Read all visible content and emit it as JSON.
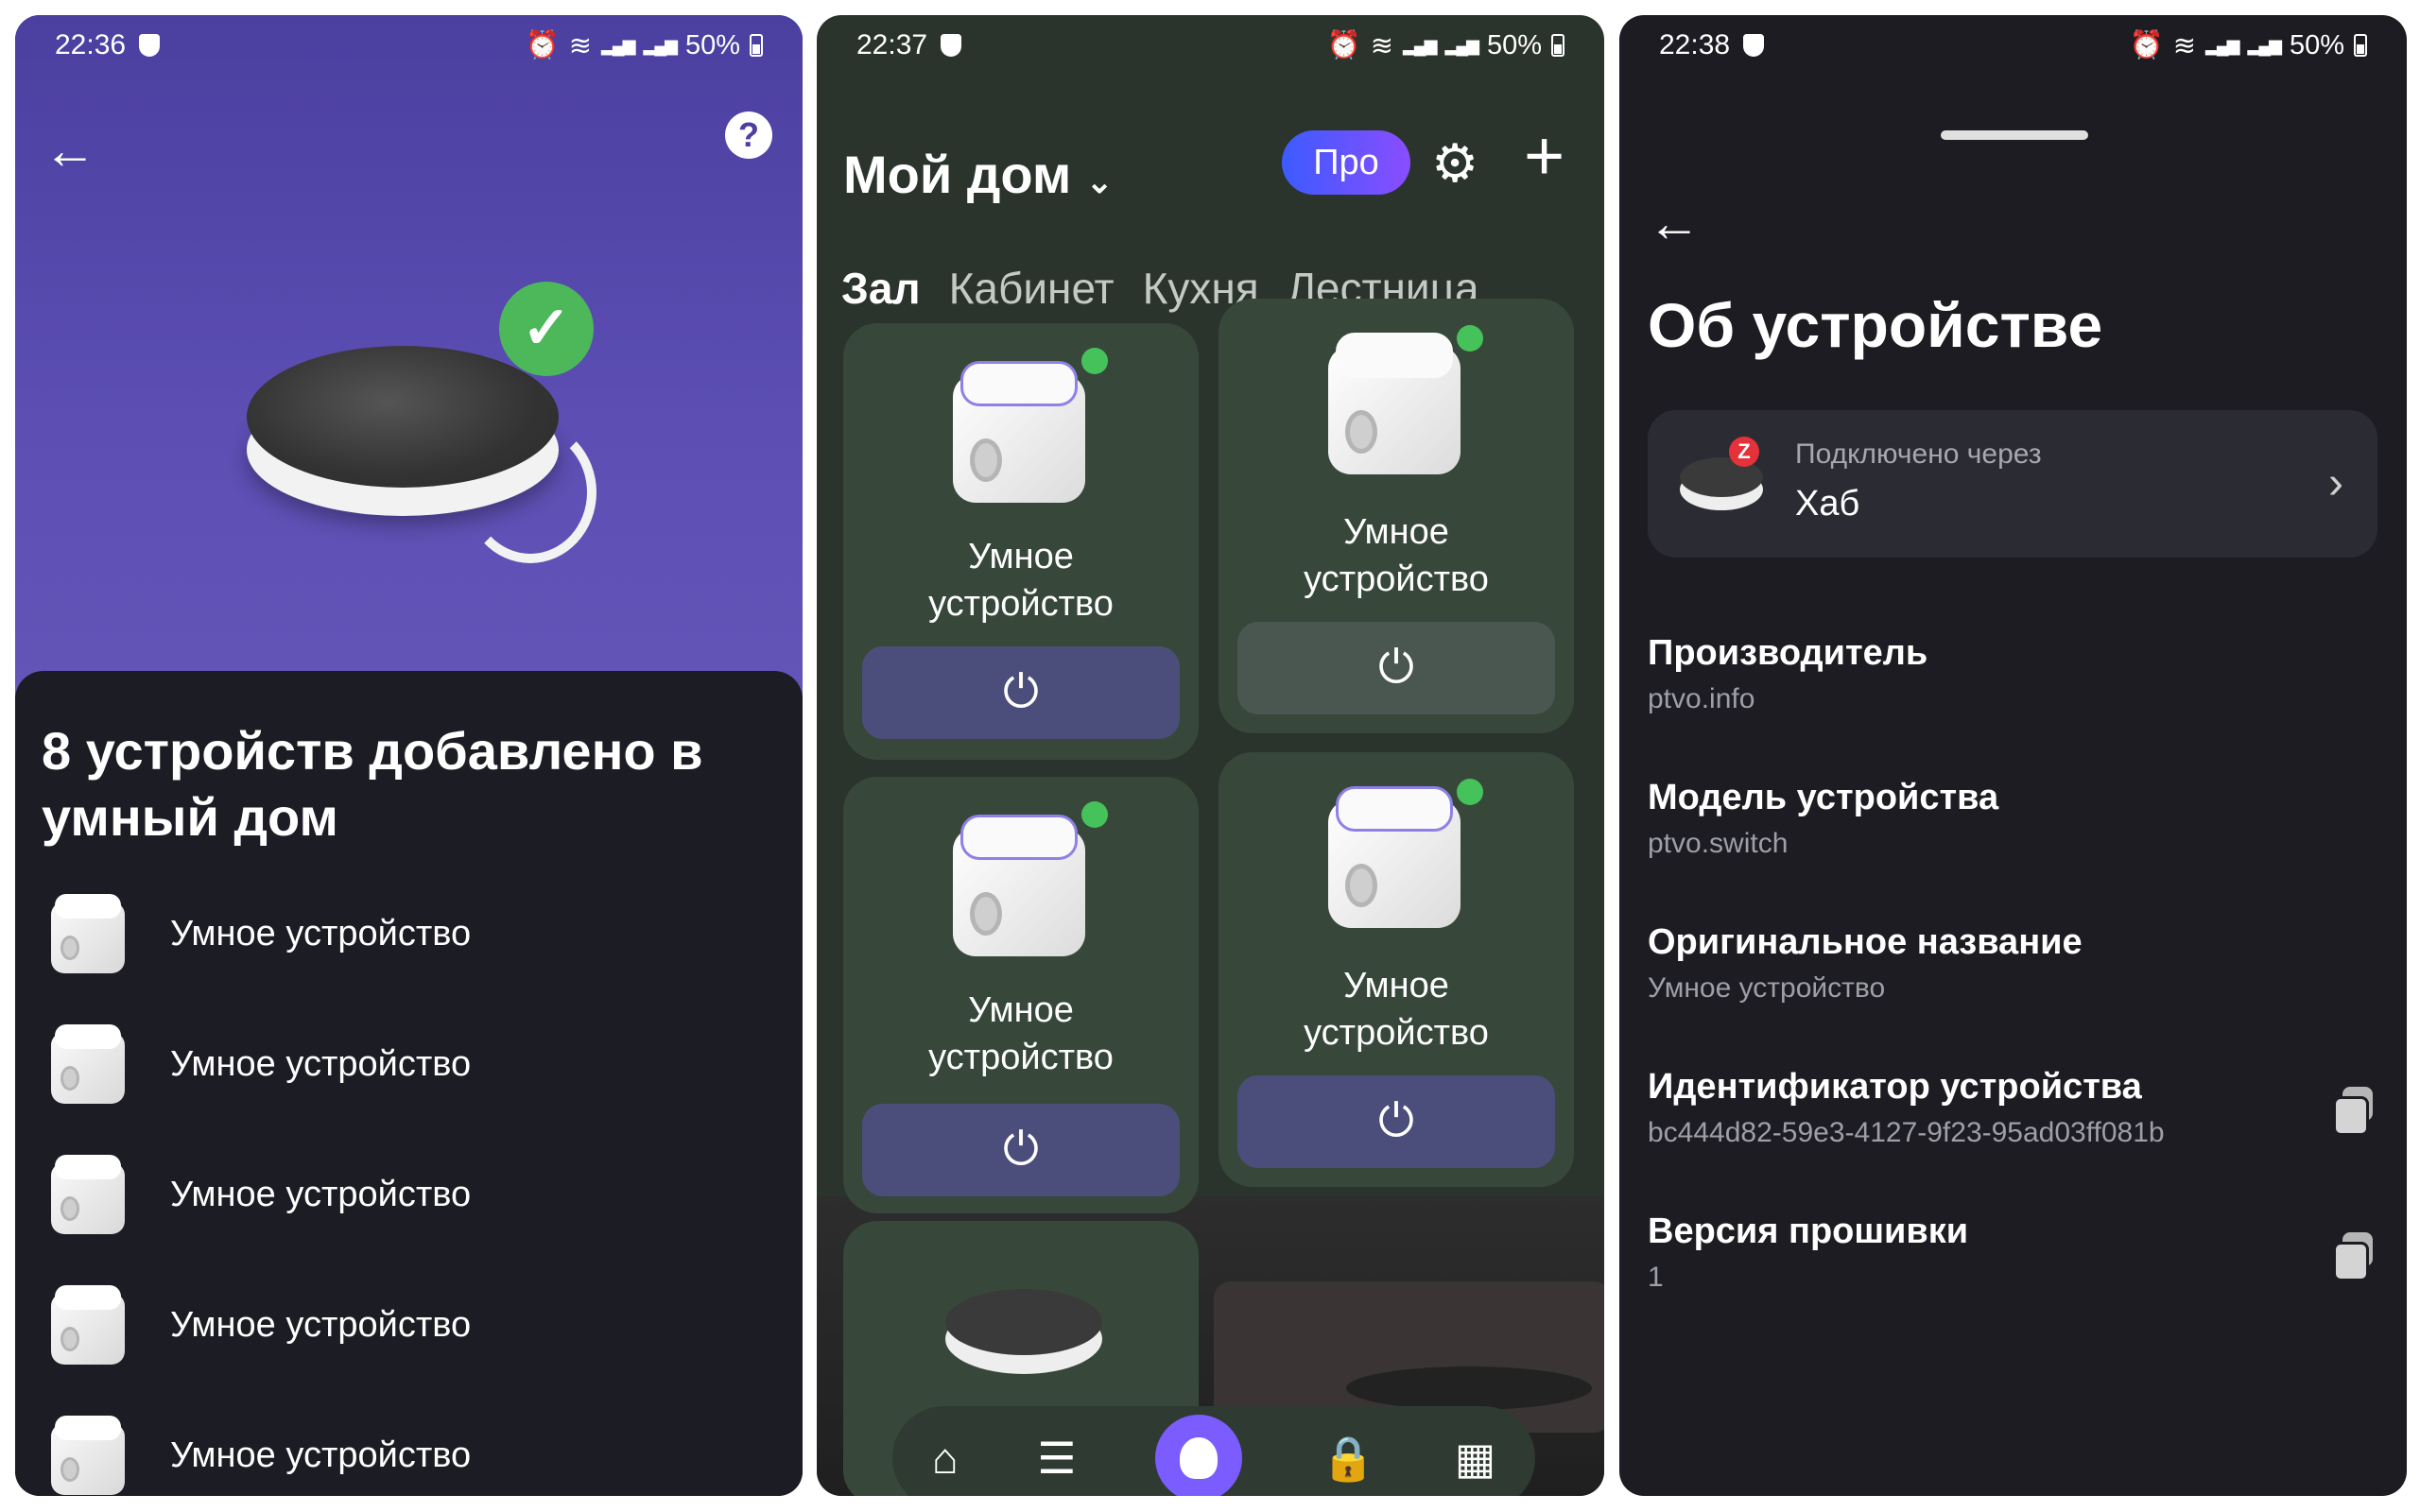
{
  "panel1": {
    "status": {
      "time": "22:36",
      "battery": "50%"
    },
    "title": "8 устройств добавлено в умный дом",
    "devices": [
      "Умное устройство",
      "Умное устройство",
      "Умное устройство",
      "Умное устройство",
      "Умное устройство"
    ]
  },
  "panel2": {
    "status": {
      "time": "22:37",
      "battery": "50%"
    },
    "home_title": "Мой дом",
    "pro_label": "Про",
    "tabs": [
      "Зал",
      "Кабинет",
      "Кухня",
      "Лестница"
    ],
    "cards": [
      {
        "name": "Умное устройство",
        "power_state": "on"
      },
      {
        "name": "Умное устройство",
        "power_state": "off"
      },
      {
        "name": "Умное устройство",
        "power_state": "on"
      },
      {
        "name": "Умное устройство",
        "power_state": "on"
      }
    ],
    "nav": [
      "home-icon",
      "routines-icon",
      "alice-icon",
      "shop-icon",
      "dashboard-icon"
    ]
  },
  "panel3": {
    "status": {
      "time": "22:38",
      "battery": "50%"
    },
    "title": "Об устройстве",
    "connected_via_label": "Подключено через",
    "connected_via_value": "Хаб",
    "fields": [
      {
        "key": "Производитель",
        "value": "ptvo.info"
      },
      {
        "key": "Модель устройства",
        "value": "ptvo.switch"
      },
      {
        "key": "Оригинальное название",
        "value": "Умное устройство"
      },
      {
        "key": "Идентификатор устройства",
        "value": "bc444d82-59e3-4127-9f23-95ad03ff081b"
      },
      {
        "key": "Версия прошивки",
        "value": "1"
      }
    ]
  },
  "colors": {
    "accent_purple": "#4b3fa0",
    "online_green": "#46c25a",
    "card_green": "#37483b",
    "power_on": "#4b4e7a"
  }
}
